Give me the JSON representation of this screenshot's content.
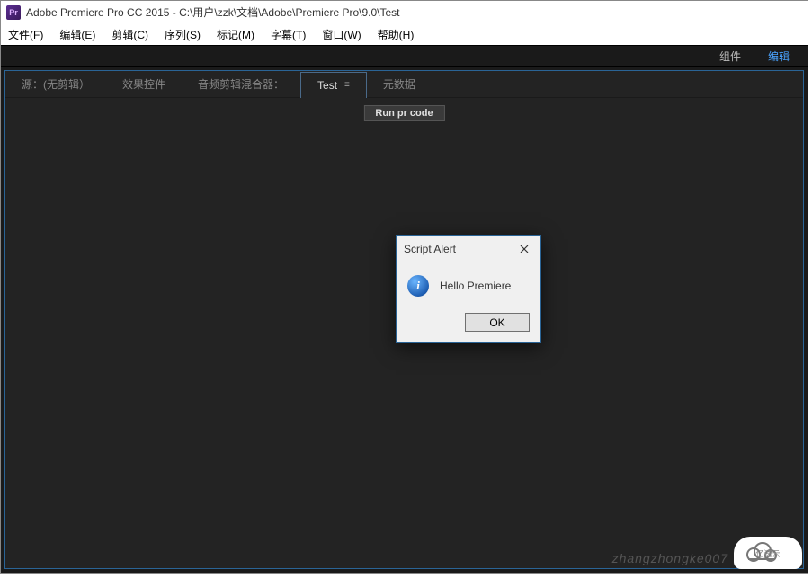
{
  "titleBar": {
    "appIconText": "Pr",
    "title": "Adobe Premiere Pro CC 2015 - C:\\用户\\zzk\\文档\\Adobe\\Premiere Pro\\9.0\\Test"
  },
  "menu": {
    "items": [
      "文件(F)",
      "编辑(E)",
      "剪辑(C)",
      "序列(S)",
      "标记(M)",
      "字幕(T)",
      "窗口(W)",
      "帮助(H)"
    ]
  },
  "subTabs": {
    "items": [
      {
        "label": "组件",
        "active": false
      },
      {
        "label": "编辑",
        "active": true
      }
    ]
  },
  "panelTabs": {
    "items": [
      {
        "label": "源：(无剪辑）",
        "active": false
      },
      {
        "label": "效果控件",
        "active": false
      },
      {
        "label": "音频剪辑混合器：",
        "active": false
      },
      {
        "label": "Test",
        "active": true
      },
      {
        "label": "元数据",
        "active": false
      }
    ]
  },
  "panel": {
    "runButton": "Run pr code"
  },
  "dialog": {
    "title": "Script Alert",
    "message": "Hello Premiere",
    "okLabel": "OK"
  },
  "watermark": {
    "text": "zhangzhongke007",
    "logo": "亿速云"
  }
}
